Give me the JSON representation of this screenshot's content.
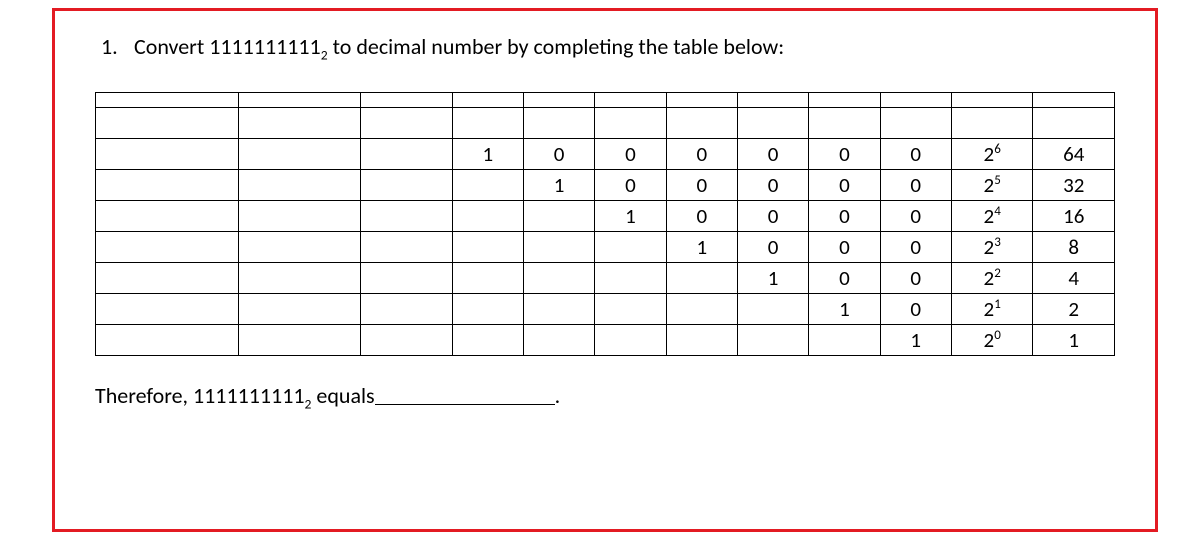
{
  "question": {
    "number": "1.",
    "text_before": "Convert 1111111111",
    "subscript": "2",
    "text_after": " to decimal number by completing the table below:"
  },
  "table": {
    "cols": 12,
    "rows": [
      [
        "",
        "",
        "",
        "1",
        "0",
        "0",
        "0",
        "0",
        "0",
        "0",
        "pow:6",
        "64"
      ],
      [
        "",
        "",
        "",
        "",
        "1",
        "0",
        "0",
        "0",
        "0",
        "0",
        "pow:5",
        "32"
      ],
      [
        "",
        "",
        "",
        "",
        "",
        "1",
        "0",
        "0",
        "0",
        "0",
        "pow:4",
        "16"
      ],
      [
        "",
        "",
        "",
        "",
        "",
        "",
        "1",
        "0",
        "0",
        "0",
        "pow:3",
        "8"
      ],
      [
        "",
        "",
        "",
        "",
        "",
        "",
        "",
        "1",
        "0",
        "0",
        "pow:2",
        "4"
      ],
      [
        "",
        "",
        "",
        "",
        "",
        "",
        "",
        "",
        "1",
        "0",
        "pow:1",
        "2"
      ],
      [
        "",
        "",
        "",
        "",
        "",
        "",
        "",
        "",
        "",
        "1",
        "pow:0",
        "1"
      ]
    ]
  },
  "conclusion": {
    "prefix": "Therefore, 1111111111",
    "subscript": "2",
    "middle": " equals",
    "suffix": "."
  }
}
